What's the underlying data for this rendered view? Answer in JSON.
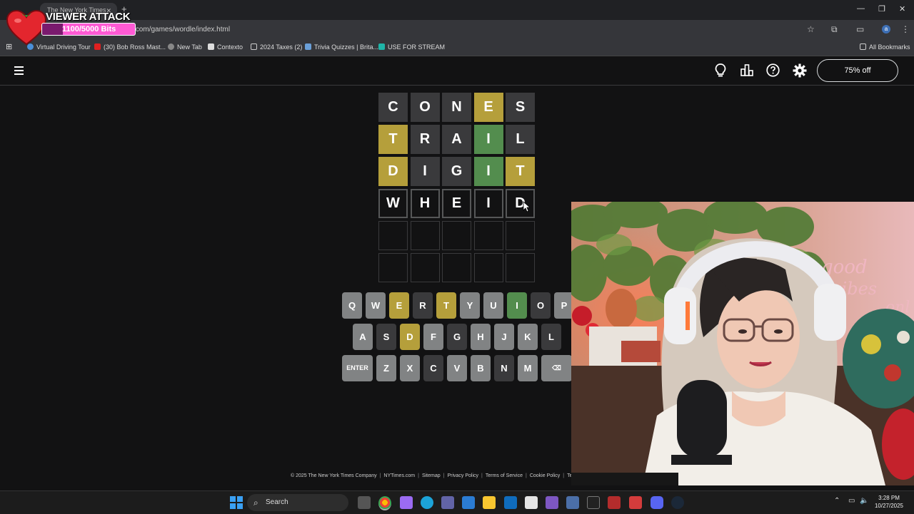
{
  "browser": {
    "tab_title": "The New York Times",
    "url": "s.com/games/wordle/index.html",
    "bookmarks": [
      {
        "label": "Virtual Driving Tour",
        "color": "#4a90d9"
      },
      {
        "label": "(30) Bob Ross Mast...",
        "color": "#e02020"
      },
      {
        "label": "New Tab",
        "color": "#888888"
      },
      {
        "label": "Contexto",
        "color": "#cccccc"
      },
      {
        "label": "2024 Taxes (2)",
        "color": "#cccccc"
      },
      {
        "label": "Trivia Quizzes | Brita...",
        "color": "#6a9fd8"
      },
      {
        "label": "USE FOR STREAM",
        "color": "#1fb5a8"
      }
    ],
    "all_bookmarks": "All Bookmarks"
  },
  "overlay": {
    "title": "VIEWER ATTACK",
    "bits_text": "1100/5000 Bits",
    "progress": 0.22
  },
  "header": {
    "promo": "75% off"
  },
  "board": {
    "rows": [
      [
        {
          "l": "C",
          "s": "absent"
        },
        {
          "l": "O",
          "s": "absent"
        },
        {
          "l": "N",
          "s": "absent"
        },
        {
          "l": "E",
          "s": "present"
        },
        {
          "l": "S",
          "s": "absent"
        }
      ],
      [
        {
          "l": "T",
          "s": "present"
        },
        {
          "l": "R",
          "s": "absent"
        },
        {
          "l": "A",
          "s": "absent"
        },
        {
          "l": "I",
          "s": "correct"
        },
        {
          "l": "L",
          "s": "absent"
        }
      ],
      [
        {
          "l": "D",
          "s": "present"
        },
        {
          "l": "I",
          "s": "absent"
        },
        {
          "l": "G",
          "s": "absent"
        },
        {
          "l": "I",
          "s": "correct"
        },
        {
          "l": "T",
          "s": "present"
        }
      ],
      [
        {
          "l": "W",
          "s": "tbd"
        },
        {
          "l": "H",
          "s": "tbd"
        },
        {
          "l": "E",
          "s": "tbd"
        },
        {
          "l": "I",
          "s": "tbd"
        },
        {
          "l": "D",
          "s": "tbd"
        }
      ],
      [
        {
          "l": "",
          "s": "empty"
        },
        {
          "l": "",
          "s": "empty"
        },
        {
          "l": "",
          "s": "empty"
        },
        {
          "l": "",
          "s": "empty"
        },
        {
          "l": "",
          "s": "empty"
        }
      ],
      [
        {
          "l": "",
          "s": "empty"
        },
        {
          "l": "",
          "s": "empty"
        },
        {
          "l": "",
          "s": "empty"
        },
        {
          "l": "",
          "s": "empty"
        },
        {
          "l": "",
          "s": "empty"
        }
      ]
    ]
  },
  "keyboard": {
    "rows": [
      [
        {
          "k": "Q",
          "s": ""
        },
        {
          "k": "W",
          "s": ""
        },
        {
          "k": "E",
          "s": "present"
        },
        {
          "k": "R",
          "s": "absent"
        },
        {
          "k": "T",
          "s": "present"
        },
        {
          "k": "Y",
          "s": ""
        },
        {
          "k": "U",
          "s": ""
        },
        {
          "k": "I",
          "s": "correct"
        },
        {
          "k": "O",
          "s": "absent"
        },
        {
          "k": "P",
          "s": ""
        }
      ],
      [
        {
          "k": "A",
          "s": ""
        },
        {
          "k": "S",
          "s": "absent"
        },
        {
          "k": "D",
          "s": "present"
        },
        {
          "k": "F",
          "s": ""
        },
        {
          "k": "G",
          "s": "absent"
        },
        {
          "k": "H",
          "s": ""
        },
        {
          "k": "J",
          "s": ""
        },
        {
          "k": "K",
          "s": ""
        },
        {
          "k": "L",
          "s": "absent"
        }
      ],
      [
        {
          "k": "ENTER",
          "s": ""
        },
        {
          "k": "Z",
          "s": ""
        },
        {
          "k": "X",
          "s": ""
        },
        {
          "k": "C",
          "s": "absent"
        },
        {
          "k": "V",
          "s": ""
        },
        {
          "k": "B",
          "s": ""
        },
        {
          "k": "N",
          "s": "absent"
        },
        {
          "k": "M",
          "s": ""
        },
        {
          "k": "⌫",
          "s": ""
        }
      ]
    ]
  },
  "footer": {
    "links": [
      "© 2025 The New York Times Company",
      "NYTimes.com",
      "Sitemap",
      "Privacy Policy",
      "Terms of Service",
      "Cookie Policy",
      "Terms of Sal"
    ]
  },
  "taskbar": {
    "search": "Search",
    "time": "3:28 PM",
    "date": "10/27/2025"
  }
}
